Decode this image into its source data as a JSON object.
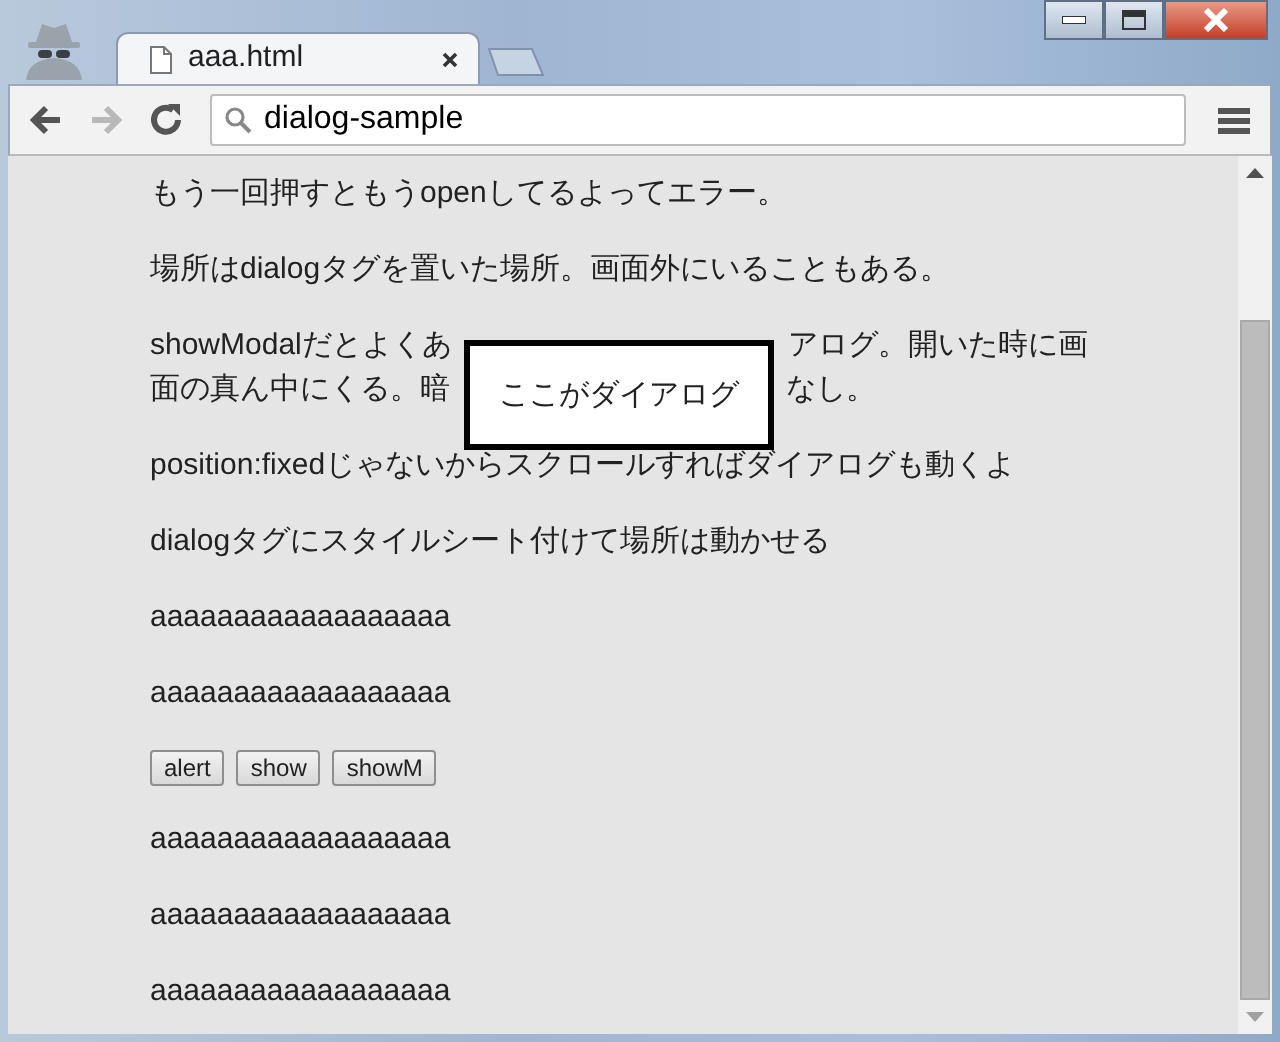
{
  "tabs": [
    {
      "title": "aaa.html",
      "selected": true
    }
  ],
  "toolbar": {
    "back_enabled": true,
    "forward_enabled": false,
    "address": "dialog-sample"
  },
  "content": [
    {
      "kind": "text",
      "text": "もう一回押すともうopenしてるよってエラー。"
    },
    {
      "kind": "text",
      "text": "場所はdialogタグを置いた場所。画面外にいることもある。"
    },
    {
      "kind": "occluded",
      "lines": [
        {
          "left": "showModalだとよくあ",
          "right": "アログ。開いた時に画"
        },
        {
          "left": "面の真ん中にくる。暗",
          "right": "なし。"
        }
      ],
      "dialog": "ここがダイアログ"
    },
    {
      "kind": "text",
      "text": "position:fixedじゃないからスクロールすればダイアログも動くよ"
    },
    {
      "kind": "text",
      "text": "dialogタグにスタイルシート付けて場所は動かせる"
    },
    {
      "kind": "text",
      "text": "aaaaaaaaaaaaaaaaaa"
    },
    {
      "kind": "text",
      "text": "aaaaaaaaaaaaaaaaaa"
    },
    {
      "kind": "buttons",
      "buttons": [
        "alert",
        "show",
        "showM"
      ]
    },
    {
      "kind": "text",
      "text": "aaaaaaaaaaaaaaaaaa"
    },
    {
      "kind": "text",
      "text": "aaaaaaaaaaaaaaaaaa"
    },
    {
      "kind": "text",
      "text": "aaaaaaaaaaaaaaaaaa"
    }
  ]
}
